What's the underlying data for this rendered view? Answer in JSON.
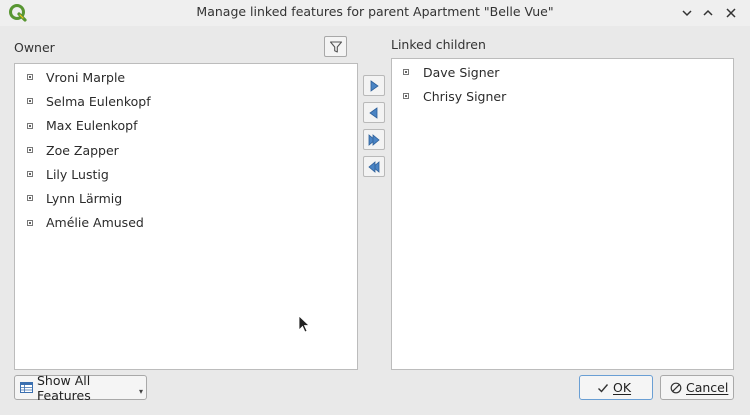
{
  "window": {
    "title": "Manage linked features for parent Apartment \"Belle Vue\""
  },
  "owner": {
    "label": "Owner",
    "items": [
      "Vroni Marple",
      "Selma Eulenkopf",
      "Max Eulenkopf",
      "Zoe Zapper",
      "Lily Lustig",
      "Lynn Lärmig",
      "Amélie Amused"
    ]
  },
  "linked": {
    "label": "Linked children",
    "items": [
      "Dave Signer",
      "Chrisy Signer"
    ]
  },
  "footer": {
    "show_all_label": "Show All Features",
    "ok_label": "OK",
    "cancel_label": "Cancel"
  },
  "colors": {
    "accent": "#3a6fb0",
    "qgis_green": "#589632",
    "qgis_yellow": "#ee7913"
  }
}
